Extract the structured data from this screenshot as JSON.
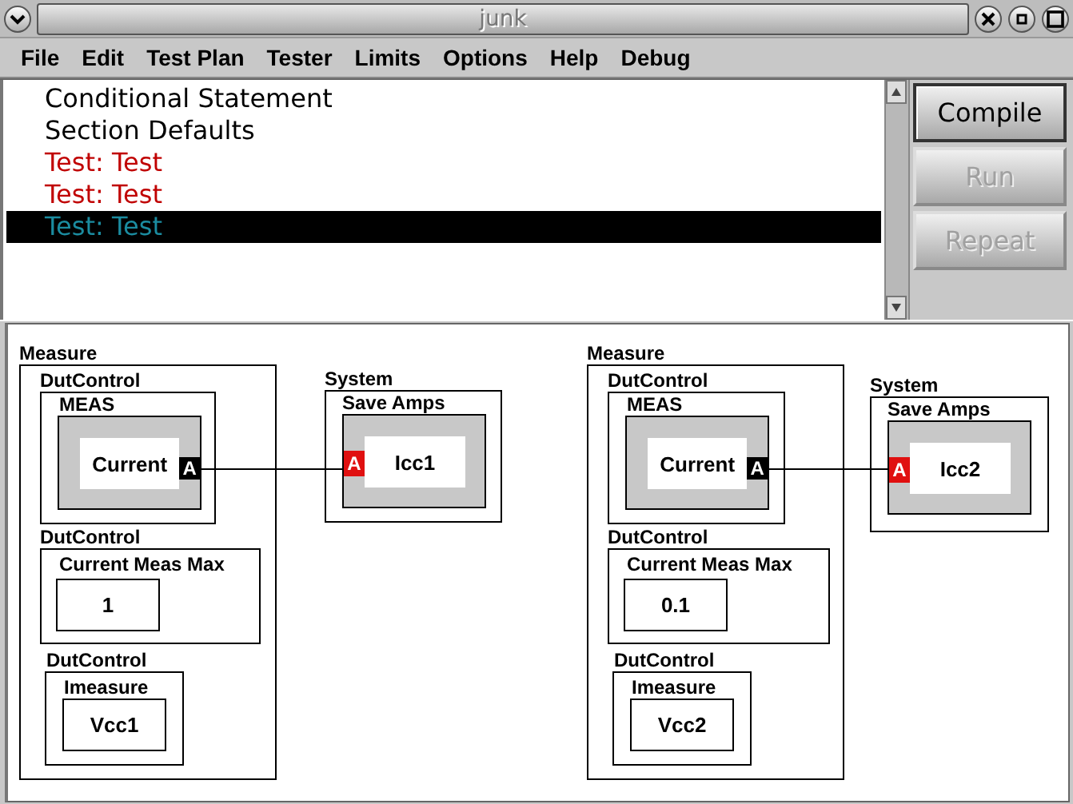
{
  "window": {
    "title": "junk"
  },
  "menu": [
    {
      "label": "File"
    },
    {
      "label": "Edit"
    },
    {
      "label": "Test Plan"
    },
    {
      "label": "Tester"
    },
    {
      "label": "Limits"
    },
    {
      "label": "Options"
    },
    {
      "label": "Help"
    },
    {
      "label": "Debug"
    }
  ],
  "list": {
    "items": [
      {
        "text": "Conditional Statement",
        "kind": "statement",
        "selected": false
      },
      {
        "text": "Section Defaults",
        "kind": "statement",
        "selected": false
      },
      {
        "text": "Test: Test",
        "kind": "test",
        "selected": false
      },
      {
        "text": "Test: Test",
        "kind": "test",
        "selected": false
      },
      {
        "text": "Test: Test",
        "kind": "test",
        "selected": true
      }
    ]
  },
  "buttons": [
    {
      "label": "Compile",
      "disabled": false
    },
    {
      "label": "Run",
      "disabled": true
    },
    {
      "label": "Repeat",
      "disabled": true
    }
  ],
  "diagram": {
    "groups": [
      {
        "measure": {
          "title": "Measure",
          "meas": {
            "title": "DutControl",
            "subtitle": "MEAS",
            "node": "Current",
            "port": {
              "label": "A",
              "kind": "output"
            }
          },
          "max": {
            "title": "DutControl",
            "subtitle": "Current Meas Max",
            "value": "1"
          },
          "imeasure": {
            "title": "DutControl",
            "subtitle": "Imeasure",
            "value": "Vcc1"
          }
        },
        "system": {
          "title": "System",
          "subtitle": "Save Amps",
          "node": "Icc1",
          "port": {
            "label": "A",
            "kind": "input"
          }
        }
      },
      {
        "measure": {
          "title": "Measure",
          "meas": {
            "title": "DutControl",
            "subtitle": "MEAS",
            "node": "Current",
            "port": {
              "label": "A",
              "kind": "output"
            }
          },
          "max": {
            "title": "DutControl",
            "subtitle": "Current Meas Max",
            "value": "0.1"
          },
          "imeasure": {
            "title": "DutControl",
            "subtitle": "Imeasure",
            "value": "Vcc2"
          }
        },
        "system": {
          "title": "System",
          "subtitle": "Save Amps",
          "node": "Icc2",
          "port": {
            "label": "A",
            "kind": "input"
          }
        }
      }
    ]
  }
}
